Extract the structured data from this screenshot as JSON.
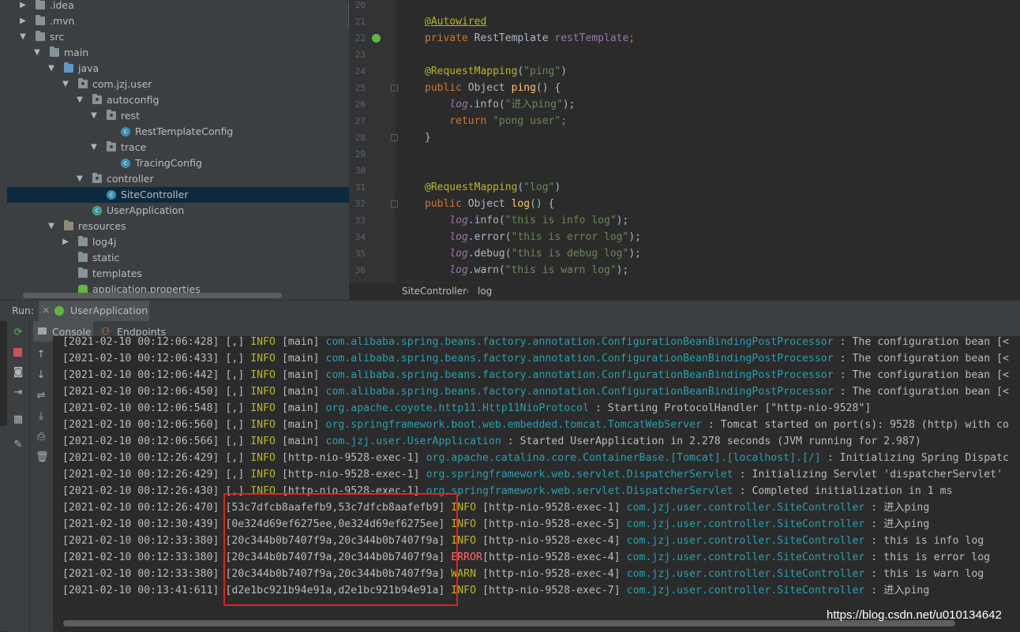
{
  "project_tree": [
    {
      "label": ".idea",
      "arrow": "▶",
      "indent": 0,
      "icon": "folder-icon"
    },
    {
      "label": ".mvn",
      "arrow": "▶",
      "indent": 0,
      "icon": "folder-icon"
    },
    {
      "label": "src",
      "arrow": "▼",
      "indent": 0,
      "icon": "folder-icon"
    },
    {
      "label": "main",
      "arrow": "▼",
      "indent": 1,
      "icon": "folder-icon"
    },
    {
      "label": "java",
      "arrow": "▼",
      "indent": 2,
      "icon": "source-folder-icon"
    },
    {
      "label": "com.jzj.user",
      "arrow": "▼",
      "indent": 3,
      "icon": "package-icon"
    },
    {
      "label": "autoconfig",
      "arrow": "▼",
      "indent": 4,
      "icon": "package-icon"
    },
    {
      "label": "rest",
      "arrow": "▼",
      "indent": 5,
      "icon": "package-icon"
    },
    {
      "label": "RestTemplateConfig",
      "arrow": "",
      "indent": 6,
      "icon": "class-icon"
    },
    {
      "label": "trace",
      "arrow": "▼",
      "indent": 5,
      "icon": "package-icon"
    },
    {
      "label": "TracingConfig",
      "arrow": "",
      "indent": 6,
      "icon": "class-icon"
    },
    {
      "label": "controller",
      "arrow": "▼",
      "indent": 4,
      "icon": "package-icon"
    },
    {
      "label": "SiteController",
      "arrow": "",
      "indent": 5,
      "icon": "class-icon",
      "selected": true
    },
    {
      "label": "UserApplication",
      "arrow": "",
      "indent": 4,
      "icon": "spring-boot-class-icon"
    },
    {
      "label": "resources",
      "arrow": "▼",
      "indent": 2,
      "icon": "resources-folder-icon"
    },
    {
      "label": "log4j",
      "arrow": "▶",
      "indent": 3,
      "icon": "folder-icon"
    },
    {
      "label": "static",
      "arrow": "",
      "indent": 3,
      "icon": "folder-icon"
    },
    {
      "label": "templates",
      "arrow": "",
      "indent": 3,
      "icon": "folder-icon"
    },
    {
      "label": "application.properties",
      "arrow": "",
      "indent": 3,
      "icon": "properties-file-icon"
    }
  ],
  "editor": {
    "lines": [
      {
        "num": "20",
        "tokens": []
      },
      {
        "num": "21",
        "tokens": [
          {
            "t": "@Autowired",
            "c": "ann"
          }
        ]
      },
      {
        "num": "22",
        "tokens": [
          {
            "t": "private ",
            "c": "kw"
          },
          {
            "t": "RestTemplate ",
            "c": ""
          },
          {
            "t": "restTemplate",
            "c": "fld"
          },
          {
            "t": ";",
            "c": "kw"
          }
        ]
      },
      {
        "num": "23",
        "tokens": []
      },
      {
        "num": "24",
        "tokens": [
          {
            "t": "@RequestMapping",
            "c": "ann"
          },
          {
            "t": "(",
            "c": ""
          },
          {
            "t": "\"ping\"",
            "c": "str"
          },
          {
            "t": ")",
            "c": ""
          }
        ]
      },
      {
        "num": "25",
        "tokens": [
          {
            "t": "public ",
            "c": "kw"
          },
          {
            "t": "Object ",
            "c": ""
          },
          {
            "t": "ping",
            "c": "fn"
          },
          {
            "t": "() {",
            "c": ""
          }
        ]
      },
      {
        "num": "26",
        "tokens": [
          {
            "t": "    ",
            "c": ""
          },
          {
            "t": "log",
            "c": "ital"
          },
          {
            "t": ".info(",
            "c": ""
          },
          {
            "t": "\"进入ping\"",
            "c": "str"
          },
          {
            "t": ");",
            "c": ""
          }
        ]
      },
      {
        "num": "27",
        "tokens": [
          {
            "t": "    ",
            "c": ""
          },
          {
            "t": "return ",
            "c": "kw"
          },
          {
            "t": "\"pong user\"",
            "c": "str"
          },
          {
            "t": ";",
            "c": "kw"
          }
        ]
      },
      {
        "num": "28",
        "tokens": [
          {
            "t": "}",
            "c": ""
          }
        ]
      },
      {
        "num": "29",
        "tokens": []
      },
      {
        "num": "30",
        "tokens": []
      },
      {
        "num": "31",
        "tokens": [
          {
            "t": "@RequestMapping",
            "c": "ann"
          },
          {
            "t": "(",
            "c": ""
          },
          {
            "t": "\"log\"",
            "c": "str"
          },
          {
            "t": ")",
            "c": ""
          }
        ]
      },
      {
        "num": "32",
        "tokens": [
          {
            "t": "public ",
            "c": "kw"
          },
          {
            "t": "Object ",
            "c": ""
          },
          {
            "t": "log",
            "c": "fn"
          },
          {
            "t": "() {",
            "c": ""
          }
        ]
      },
      {
        "num": "33",
        "tokens": [
          {
            "t": "    ",
            "c": ""
          },
          {
            "t": "log",
            "c": "ital"
          },
          {
            "t": ".info(",
            "c": ""
          },
          {
            "t": "\"this is info log\"",
            "c": "str"
          },
          {
            "t": ");",
            "c": ""
          }
        ]
      },
      {
        "num": "34",
        "tokens": [
          {
            "t": "    ",
            "c": ""
          },
          {
            "t": "log",
            "c": "ital"
          },
          {
            "t": ".error(",
            "c": ""
          },
          {
            "t": "\"this is error log\"",
            "c": "str"
          },
          {
            "t": ");",
            "c": ""
          }
        ]
      },
      {
        "num": "35",
        "tokens": [
          {
            "t": "    ",
            "c": ""
          },
          {
            "t": "log",
            "c": "ital"
          },
          {
            "t": ".debug(",
            "c": ""
          },
          {
            "t": "\"this is debug log\"",
            "c": "str"
          },
          {
            "t": ");",
            "c": ""
          }
        ]
      },
      {
        "num": "36",
        "tokens": [
          {
            "t": "    ",
            "c": ""
          },
          {
            "t": "log",
            "c": "ital"
          },
          {
            "t": ".warn(",
            "c": ""
          },
          {
            "t": "\"this is warn log\"",
            "c": "str"
          },
          {
            "t": ");",
            "c": ""
          }
        ]
      }
    ],
    "breadcrumb": {
      "file": "SiteController",
      "separator": "›",
      "method": "log"
    }
  },
  "run_panel": {
    "label": "Run:",
    "tab_label": "UserApplication",
    "close_glyph": "×",
    "console_tab": "Console",
    "endpoints_tab": "Endpoints"
  },
  "console_lines": [
    {
      "ts": "[2021-02-10 00:12:06:428]",
      "trace": "[,]",
      "level": "INFO",
      "lvc": "lv-info",
      "thread": "[main]",
      "logger": "com.alibaba.spring.beans.factory.annotation.ConfigurationBeanBindingPostProcessor",
      "msg": " : The configuration bean [<"
    },
    {
      "ts": "[2021-02-10 00:12:06:433]",
      "trace": "[,]",
      "level": "INFO",
      "lvc": "lv-info",
      "thread": "[main]",
      "logger": "com.alibaba.spring.beans.factory.annotation.ConfigurationBeanBindingPostProcessor",
      "msg": " : The configuration bean [<"
    },
    {
      "ts": "[2021-02-10 00:12:06:442]",
      "trace": "[,]",
      "level": "INFO",
      "lvc": "lv-info",
      "thread": "[main]",
      "logger": "com.alibaba.spring.beans.factory.annotation.ConfigurationBeanBindingPostProcessor",
      "msg": " : The configuration bean [<"
    },
    {
      "ts": "[2021-02-10 00:12:06:450]",
      "trace": "[,]",
      "level": "INFO",
      "lvc": "lv-info",
      "thread": "[main]",
      "logger": "com.alibaba.spring.beans.factory.annotation.ConfigurationBeanBindingPostProcessor",
      "msg": " : The configuration bean [<"
    },
    {
      "ts": "[2021-02-10 00:12:06:548]",
      "trace": "[,]",
      "level": "INFO",
      "lvc": "lv-info",
      "thread": "[main]",
      "logger": "org.apache.coyote.http11.Http11NioProtocol",
      "msg": " : Starting ProtocolHandler [\"http-nio-9528\"]"
    },
    {
      "ts": "[2021-02-10 00:12:06:560]",
      "trace": "[,]",
      "level": "INFO",
      "lvc": "lv-info",
      "thread": "[main]",
      "logger": "org.springframework.boot.web.embedded.tomcat.TomcatWebServer",
      "msg": " : Tomcat started on port(s): 9528 (http) with co"
    },
    {
      "ts": "[2021-02-10 00:12:06:566]",
      "trace": "[,]",
      "level": "INFO",
      "lvc": "lv-info",
      "thread": "[main]",
      "logger": "com.jzj.user.UserApplication",
      "msg": " : Started UserApplication in 2.278 seconds (JVM running for 2.987)"
    },
    {
      "ts": "[2021-02-10 00:12:26:429]",
      "trace": "[,]",
      "level": "INFO",
      "lvc": "lv-info",
      "thread": "[http-nio-9528-exec-1]",
      "logger": "org.apache.catalina.core.ContainerBase.[Tomcat].[localhost].[/]",
      "msg": " : Initializing Spring Dispatc"
    },
    {
      "ts": "[2021-02-10 00:12:26:429]",
      "trace": "[,]",
      "level": "INFO",
      "lvc": "lv-info",
      "thread": "[http-nio-9528-exec-1]",
      "logger": "org.springframework.web.servlet.DispatcherServlet",
      "msg": " : Initializing Servlet 'dispatcherServlet'"
    },
    {
      "ts": "[2021-02-10 00:12:26:430]",
      "trace": "[,]",
      "level": "INFO",
      "lvc": "lv-info",
      "thread": "[http-nio-9528-exec-1]",
      "logger": "org.springframework.web.servlet.DispatcherServlet",
      "msg": " : Completed initialization in 1 ms"
    },
    {
      "ts": "[2021-02-10 00:12:26:470]",
      "trace": "[53c7dfcb8aafefb9,53c7dfcb8aafefb9]",
      "level": "INFO",
      "lvc": "lv-info",
      "thread": "[http-nio-9528-exec-1]",
      "logger": "com.jzj.user.controller.SiteController",
      "msg": " : 进入ping"
    },
    {
      "ts": "[2021-02-10 00:12:30:439]",
      "trace": "[0e324d69ef6275ee,0e324d69ef6275ee]",
      "level": "INFO",
      "lvc": "lv-info",
      "thread": "[http-nio-9528-exec-5]",
      "logger": "com.jzj.user.controller.SiteController",
      "msg": " : 进入ping"
    },
    {
      "ts": "[2021-02-10 00:12:33:380]",
      "trace": "[20c344b0b7407f9a,20c344b0b7407f9a]",
      "level": "INFO",
      "lvc": "lv-info",
      "thread": "[http-nio-9528-exec-4]",
      "logger": "com.jzj.user.controller.SiteController",
      "msg": " : this is info log"
    },
    {
      "ts": "[2021-02-10 00:12:33:380]",
      "trace": "[20c344b0b7407f9a,20c344b0b7407f9a]",
      "level": "ERROR",
      "lvc": "lv-err",
      "thread": "[http-nio-9528-exec-4]",
      "logger": "com.jzj.user.controller.SiteController",
      "msg": " : this is error log"
    },
    {
      "ts": "[2021-02-10 00:12:33:380]",
      "trace": "[20c344b0b7407f9a,20c344b0b7407f9a]",
      "level": "WARN",
      "lvc": "lv-info",
      "thread": "[http-nio-9528-exec-4]",
      "logger": "com.jzj.user.controller.SiteController",
      "msg": " : this is warn log"
    },
    {
      "ts": "[2021-02-10 00:13:41:611]",
      "trace": "[d2e1bc921b94e91a,d2e1bc921b94e91a]",
      "level": "INFO",
      "lvc": "lv-info",
      "thread": "[http-nio-9528-exec-7]",
      "logger": "com.jzj.user.controller.SiteController",
      "msg": " : 进入ping"
    }
  ],
  "watermark": "https://blog.csdn.net/u010134642",
  "colors": {
    "highlight_box": "#e0231e",
    "selection": "#0d293e",
    "logger": "#2a9fb2"
  }
}
